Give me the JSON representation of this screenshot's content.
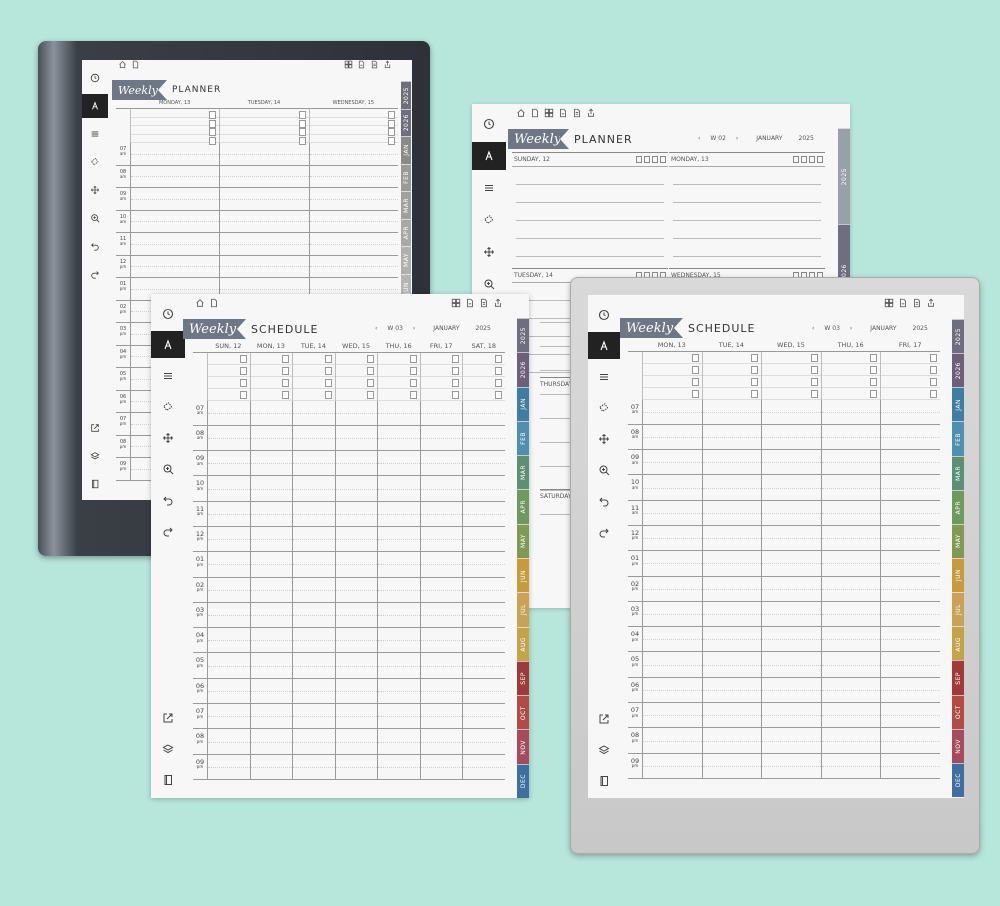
{
  "brand_flag": "Weekly",
  "icons": {
    "toolbar": [
      "history-icon",
      "pen-icon",
      "menu-lines-icon",
      "eraser-icon",
      "move-icon",
      "zoom-icon",
      "undo-icon",
      "redo-icon"
    ],
    "toolbar_bottom": [
      "export-icon",
      "layers-icon",
      "page-icon"
    ],
    "top": [
      "home-icon",
      "document-icon",
      "grid-icon",
      "file-a-icon",
      "file-b-icon",
      "share-icon"
    ]
  },
  "tab_colors": [
    "#6e6e7e",
    "#6d5e7a",
    "#3f7ea0",
    "#4f8fb0",
    "#5c8f74",
    "#6f9a5f",
    "#7f9a55",
    "#c79a3a",
    "#c9a355",
    "#c3a24a",
    "#9e3b3a",
    "#b04b45",
    "#a54b5c",
    "#3f6f9f"
  ],
  "tabs_full": [
    "2025",
    "2026",
    "JAN",
    "FEB",
    "MAR",
    "APR",
    "MAY",
    "JUN",
    "JUL",
    "AUG",
    "SEP",
    "OCT",
    "NOV",
    "DEC"
  ],
  "hours": [
    {
      "h": "07",
      "p": "am"
    },
    {
      "h": "08",
      "p": "am"
    },
    {
      "h": "09",
      "p": "am"
    },
    {
      "h": "10",
      "p": "am"
    },
    {
      "h": "11",
      "p": "am"
    },
    {
      "h": "12",
      "p": "pm"
    },
    {
      "h": "01",
      "p": "pm"
    },
    {
      "h": "02",
      "p": "pm"
    },
    {
      "h": "03",
      "p": "pm"
    },
    {
      "h": "04",
      "p": "pm"
    },
    {
      "h": "05",
      "p": "pm"
    },
    {
      "h": "06",
      "p": "pm"
    },
    {
      "h": "07",
      "p": "pm"
    },
    {
      "h": "08",
      "p": "pm"
    },
    {
      "h": "09",
      "p": "pm"
    }
  ],
  "page1": {
    "title": "PLANNER",
    "days": [
      "MONDAY, 13",
      "TUESDAY, 14",
      "WEDNESDAY, 15"
    ]
  },
  "page2": {
    "title": "PLANNER",
    "week": "W 02",
    "month": "JANUARY",
    "year": "2025",
    "boxes": [
      "SUNDAY, 12",
      "MONDAY, 13",
      "TUESDAY, 14",
      "WEDNESDAY, 15"
    ],
    "partial_rows": [
      "THURSDAY, 16",
      "SATURDAY, 18"
    ]
  },
  "page3": {
    "title": "SCHEDULE",
    "week": "W 03",
    "month": "JANUARY",
    "year": "2025",
    "days": [
      "SUN, 12",
      "MON, 13",
      "TUE, 14",
      "WED, 15",
      "THU, 16",
      "FRI, 17",
      "SAT, 18"
    ]
  },
  "page4": {
    "title": "SCHEDULE",
    "week": "W 03",
    "month": "JANUARY",
    "year": "2025",
    "days": [
      "MON, 13",
      "TUE, 14",
      "WED, 15",
      "THU, 16",
      "FRI, 17"
    ]
  }
}
